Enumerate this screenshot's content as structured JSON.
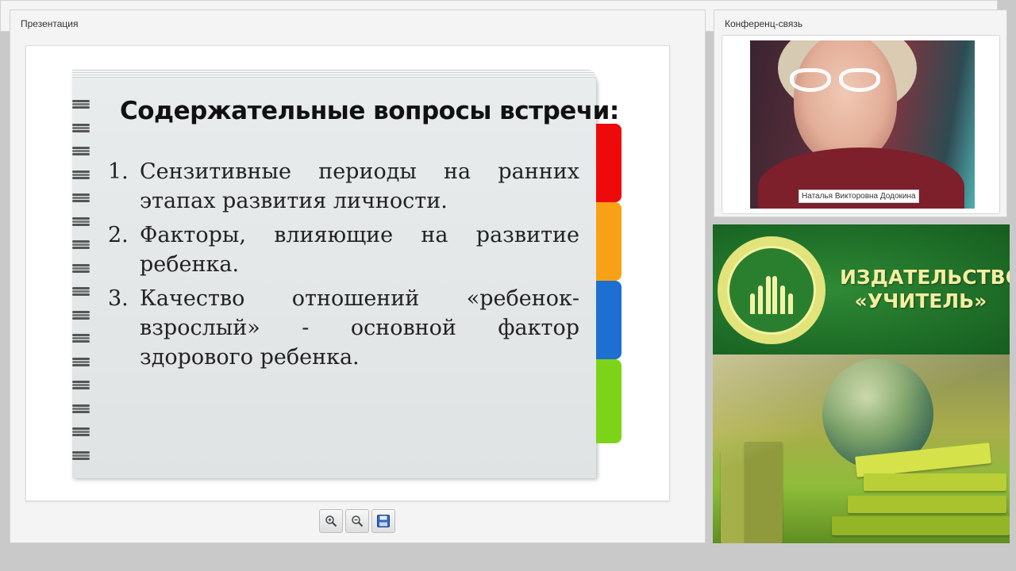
{
  "presentation": {
    "title": "Презентация",
    "slide": {
      "heading": "Содержательные вопросы встречи:",
      "items": [
        {
          "num": "1.",
          "text": "Сензитивные периоды на ранних этапах развития личности."
        },
        {
          "num": "2.",
          "text": "Факторы, влияющие на развитие ребенка."
        },
        {
          "num": "3.",
          "text": "Качество отношений «ребенок-взрослый» - основной фактор здорового ребенка."
        }
      ],
      "tab_colors": [
        "#ee0a0a",
        "#f7a117",
        "#1d6fd1",
        "#7dd317"
      ]
    },
    "toolbar": {
      "zoom_in_icon": "zoom-in-icon",
      "zoom_out_icon": "zoom-out-icon",
      "save_icon": "save-icon"
    }
  },
  "conference": {
    "title": "Конференц-связь",
    "participant_name": "Наталья Викторовна Додокина"
  },
  "publisher": {
    "name_line1": "ИЗДАТЕЛЬСТВО",
    "name_line2": "«УЧИТЕЛЬ»"
  }
}
